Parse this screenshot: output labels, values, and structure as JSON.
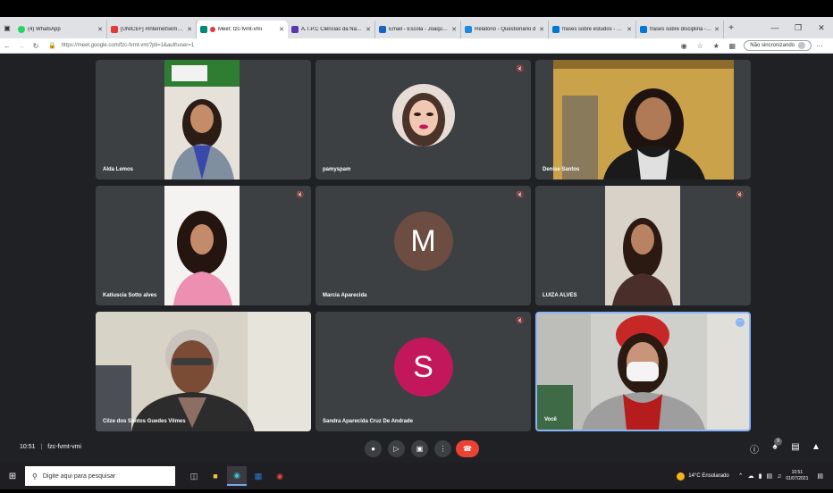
{
  "browser": {
    "tabs": [
      {
        "title": "(4) WhatsApp",
        "color": "#25d366"
      },
      {
        "title": "[UNICEF] #InternetSemVio",
        "color": "#e53935"
      },
      {
        "title": "Meet: fzc-fvmt-vmi",
        "color": "#00897b",
        "active": true
      },
      {
        "title": "A.T.P.C Ciências da Natureza",
        "color": "#5e35b1"
      },
      {
        "title": "Email - Escola - Joaquim F",
        "color": "#1565c0"
      },
      {
        "title": "Relatório - Questionário d",
        "color": "#1e88e5"
      },
      {
        "title": "frases sobre estudos - Bin",
        "color": "#0078d4"
      },
      {
        "title": "frases sobre disciplina - Bi",
        "color": "#0078d4"
      }
    ],
    "new_tab_icon": "+",
    "url": "https://meet.google.com/fzc-fvmt-vmi?pli=1&authuser=1",
    "sync_label": "Não sincronizando"
  },
  "meet": {
    "participants": [
      {
        "name": "Alda Lemos",
        "type": "video",
        "muted": false
      },
      {
        "name": "pamyspam",
        "type": "photo",
        "muted": true
      },
      {
        "name": "Denise Santos",
        "type": "video",
        "muted": false
      },
      {
        "name": "Katiuscia Sotto alves",
        "type": "video",
        "muted": true
      },
      {
        "name": "Marcia Aparecida",
        "type": "initial",
        "initial": "M",
        "color": "#6d4c41",
        "muted": true
      },
      {
        "name": "LUIZA ALVES",
        "type": "video",
        "muted": true
      },
      {
        "name": "Cilze dos Santos Guedes Vilmes",
        "type": "video",
        "muted": false
      },
      {
        "name": "Sandra Aparecida Cruz De Andrade",
        "type": "initial",
        "initial": "S",
        "color": "#c2185b",
        "muted": true
      },
      {
        "name": "Você",
        "type": "video",
        "muted": false,
        "self": true
      }
    ],
    "time": "10:51",
    "meeting_code": "fzc-fvmt-vmi",
    "participant_count": "9",
    "end_call_color": "#ea4335"
  },
  "taskbar": {
    "search_placeholder": "Digite aqui para pesquisar",
    "weather": "14°C  Ensolarado",
    "clock_time": "10:51",
    "clock_date": "01/07/2021"
  }
}
